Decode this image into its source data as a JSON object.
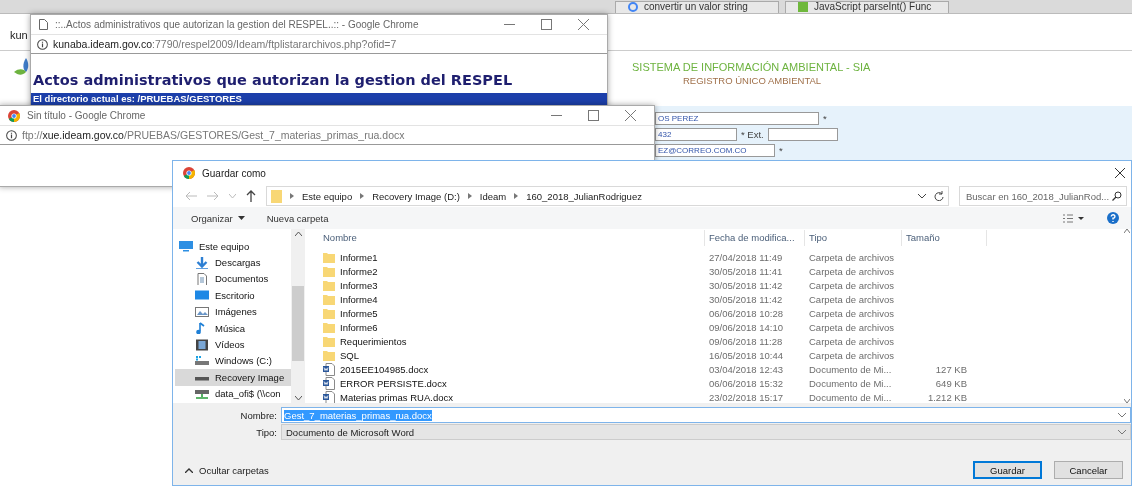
{
  "browser": {
    "tabs": [
      {
        "title": "convertir un valor string",
        "kind": "search-site"
      },
      {
        "title": "JavaScript parseInt() Func",
        "kind": "sheet"
      }
    ],
    "address": "kun",
    "page": {
      "title": "SISTEMA DE INFORMACIÓN AMBIENTAL - SIA",
      "subtitle": "REGISTRO ÚNICO AMBIENTAL",
      "form_rows": [
        {
          "kind": "text",
          "value": "OS PEREZ",
          "after": "*"
        },
        {
          "kind": "phone",
          "value": "432",
          "after": "* Ext."
        },
        {
          "kind": "text",
          "value": "EZ@CORREO.COM.CO",
          "after": "*"
        }
      ]
    }
  },
  "popup_window": {
    "title": "::..Actos administrativos que autorizan la gestion del RESPEL..:: - Google Chrome",
    "address_host": "kunaba.ideam.gov.co",
    "address_rest": ":7790/respel2009/Ideam/ftplistararchivos.php?ofid=7",
    "heading": "Actos administrativos que autorizan la gestion del RESPEL",
    "directory_bar": "El directorio actual es: /PRUEBAS/GESTORES"
  },
  "ftp_window": {
    "title": "Sin título - Google Chrome",
    "address_scheme": "ftp://",
    "address_host": "xue.ideam.gov.co",
    "address_rest": "/PRUEBAS/GESTORES/Gest_7_materias_primas_rua.docx"
  },
  "save_dialog": {
    "title": "Guardar como",
    "breadcrumb": [
      "Este equipo",
      "Recovery Image (D:)",
      "Ideam",
      "160_2018_JulianRodriguez"
    ],
    "search_placeholder": "Buscar en 160_2018_JulianRod...",
    "toolbar": [
      "Organizar",
      "Nueva carpeta"
    ],
    "sidebar": [
      {
        "label": "Este equipo",
        "kind": "computer",
        "selected": false
      },
      {
        "label": "Descargas",
        "kind": "download",
        "selected": false
      },
      {
        "label": "Documentos",
        "kind": "documents",
        "selected": false
      },
      {
        "label": "Escritorio",
        "kind": "desktop",
        "selected": false
      },
      {
        "label": "Imágenes",
        "kind": "pictures",
        "selected": false
      },
      {
        "label": "Música",
        "kind": "music",
        "selected": false
      },
      {
        "label": "Vídeos",
        "kind": "videos",
        "selected": false
      },
      {
        "label": "Windows  (C:)",
        "kind": "system-drive",
        "selected": false
      },
      {
        "label": "Recovery Image",
        "kind": "drive",
        "selected": true
      },
      {
        "label": "data_ofi$ (\\\\con",
        "kind": "network",
        "selected": false
      }
    ],
    "columns": [
      "Nombre",
      "Fecha de modifica...",
      "Tipo",
      "Tamaño"
    ],
    "files": [
      {
        "kind": "folder",
        "name": "Informe1",
        "date": "27/04/2018 11:49",
        "type": "Carpeta de archivos"
      },
      {
        "kind": "folder",
        "name": "Informe2",
        "date": "30/05/2018 11:41",
        "type": "Carpeta de archivos"
      },
      {
        "kind": "folder",
        "name": "Informe3",
        "date": "30/05/2018 11:42",
        "type": "Carpeta de archivos"
      },
      {
        "kind": "folder",
        "name": "Informe4",
        "date": "30/05/2018 11:42",
        "type": "Carpeta de archivos"
      },
      {
        "kind": "folder",
        "name": "Informe5",
        "date": "06/06/2018 10:28",
        "type": "Carpeta de archivos"
      },
      {
        "kind": "folder",
        "name": "Informe6",
        "date": "09/06/2018 14:10",
        "type": "Carpeta de archivos"
      },
      {
        "kind": "folder",
        "name": "Requerimientos",
        "date": "09/06/2018 11:28",
        "type": "Carpeta de archivos"
      },
      {
        "kind": "folder",
        "name": "SQL",
        "date": "16/05/2018 10:44",
        "type": "Carpeta de archivos"
      },
      {
        "kind": "word",
        "name": "2015EE104985.docx",
        "date": "03/04/2018 12:43",
        "type": "Documento de Mi...",
        "size": "127 KB"
      },
      {
        "kind": "word",
        "name": "ERROR PERSISTE.docx",
        "date": "06/06/2018 15:32",
        "type": "Documento de Mi...",
        "size": "649 KB"
      },
      {
        "kind": "word",
        "name": "Materias primas RUA.docx",
        "date": "23/02/2018 15:17",
        "type": "Documento de Mi...",
        "size": "1.212 KB"
      }
    ],
    "filename_label": "Nombre:",
    "filename": "Gest_7_materias_primas_rua.docx",
    "filetype_label": "Tipo:",
    "filetype": "Documento de Microsoft Word",
    "hide_folders": "Ocultar carpetas",
    "buttons": [
      {
        "label": "Guardar",
        "default": true
      },
      {
        "label": "Cancelar",
        "default": false
      }
    ]
  }
}
